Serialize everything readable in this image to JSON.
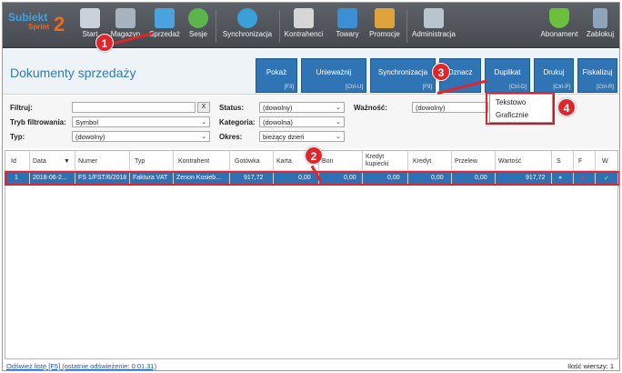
{
  "logo": {
    "name": "Subiekt",
    "sub": "Sprint",
    "num": "2"
  },
  "toolbar": {
    "items": [
      {
        "label": "Start",
        "icon": "store-icon",
        "color": "#c9d2da"
      },
      {
        "label": "Magazyn",
        "icon": "warehouse-icon",
        "color": "#a7b4bf"
      },
      {
        "label": "Sprzedaż",
        "icon": "sales-register-icon",
        "color": "#4aa3df"
      },
      {
        "label": "Sesje",
        "icon": "session-icon",
        "color": "#5bb54a"
      },
      {
        "label": "Synchronizacja",
        "icon": "sync-icon",
        "color": "#3aa0d8"
      },
      {
        "label": "Kontrahenci",
        "icon": "contractors-icon",
        "color": "#d6d6d6"
      },
      {
        "label": "Towary",
        "icon": "goods-icon",
        "color": "#3b8fd4"
      },
      {
        "label": "Promocje",
        "icon": "promotions-icon",
        "color": "#e0a23a"
      },
      {
        "label": "Administracja",
        "icon": "admin-tools-icon",
        "color": "#b9c4cd"
      },
      {
        "label": "Abonament",
        "icon": "subscription-shield-icon",
        "color": "#6cbf3a"
      },
      {
        "label": "Zablokuj",
        "icon": "lock-icon",
        "color": "#8da4bb"
      }
    ]
  },
  "header": {
    "title": "Dokumenty sprzedaży",
    "actions": [
      {
        "label": "Pokaż",
        "key": "[F3]"
      },
      {
        "label": "Unieważnij",
        "key": "[Ctrl-U]"
      },
      {
        "label": "Synchronizacja",
        "key": "[F9]"
      },
      {
        "label": "Oznacz",
        "key": ""
      },
      {
        "label": "Duplikat",
        "key": "[Ctrl-D]"
      },
      {
        "label": "Drukuj",
        "key": "[Ctrl-P]"
      },
      {
        "label": "Fiskalizuj",
        "key": "[Ctrl-R]"
      }
    ]
  },
  "filters": {
    "filter_label": "Filtruj:",
    "filter_value": "",
    "clear_label": "X",
    "mode_label": "Tryb filtrowania:",
    "mode_value": "Symbol",
    "type_label": "Typ:",
    "type_value": "(dowolny)",
    "status_label": "Status:",
    "status_value": "(dowolny)",
    "category_label": "Kategoria:",
    "category_value": "(dowolna)",
    "period_label": "Okres:",
    "period_value": "bieżący dzień",
    "validity_label": "Ważność:",
    "validity_value": "(dowolny)"
  },
  "menu": {
    "items": [
      "Tekstowo",
      "Graficznie"
    ]
  },
  "grid": {
    "columns": [
      "Id",
      "Data",
      "Numer",
      "Typ",
      "Kontrahent",
      "Gotówka",
      "Karta",
      "Bon",
      "Kredyt kupiecki",
      "Kredyt",
      "Przelew",
      "Wartość",
      "S",
      "F",
      "W"
    ],
    "row": {
      "id": "1",
      "date": "2018-06-2...",
      "number": "FS 1/FST/6/2018",
      "type": "Faktura VAT",
      "contractor": "Zenon Kosieb...",
      "cash": "917,72",
      "card": "0,00",
      "voucher": "0,00",
      "merchant_credit": "0,00",
      "credit": "0,00",
      "transfer": "0,00",
      "value": "917,72",
      "s": "●",
      "f": "✕",
      "w": "✔"
    }
  },
  "status": {
    "refresh": "Odśwież listę [F5] (ostatnie odświeżenie: 0:01.31)",
    "rows": "Ilość wierszy: 1"
  },
  "annotations": [
    "1",
    "2",
    "3",
    "4"
  ],
  "colors": {
    "accent": "#2f74b5",
    "highlight": "#e0262d"
  }
}
